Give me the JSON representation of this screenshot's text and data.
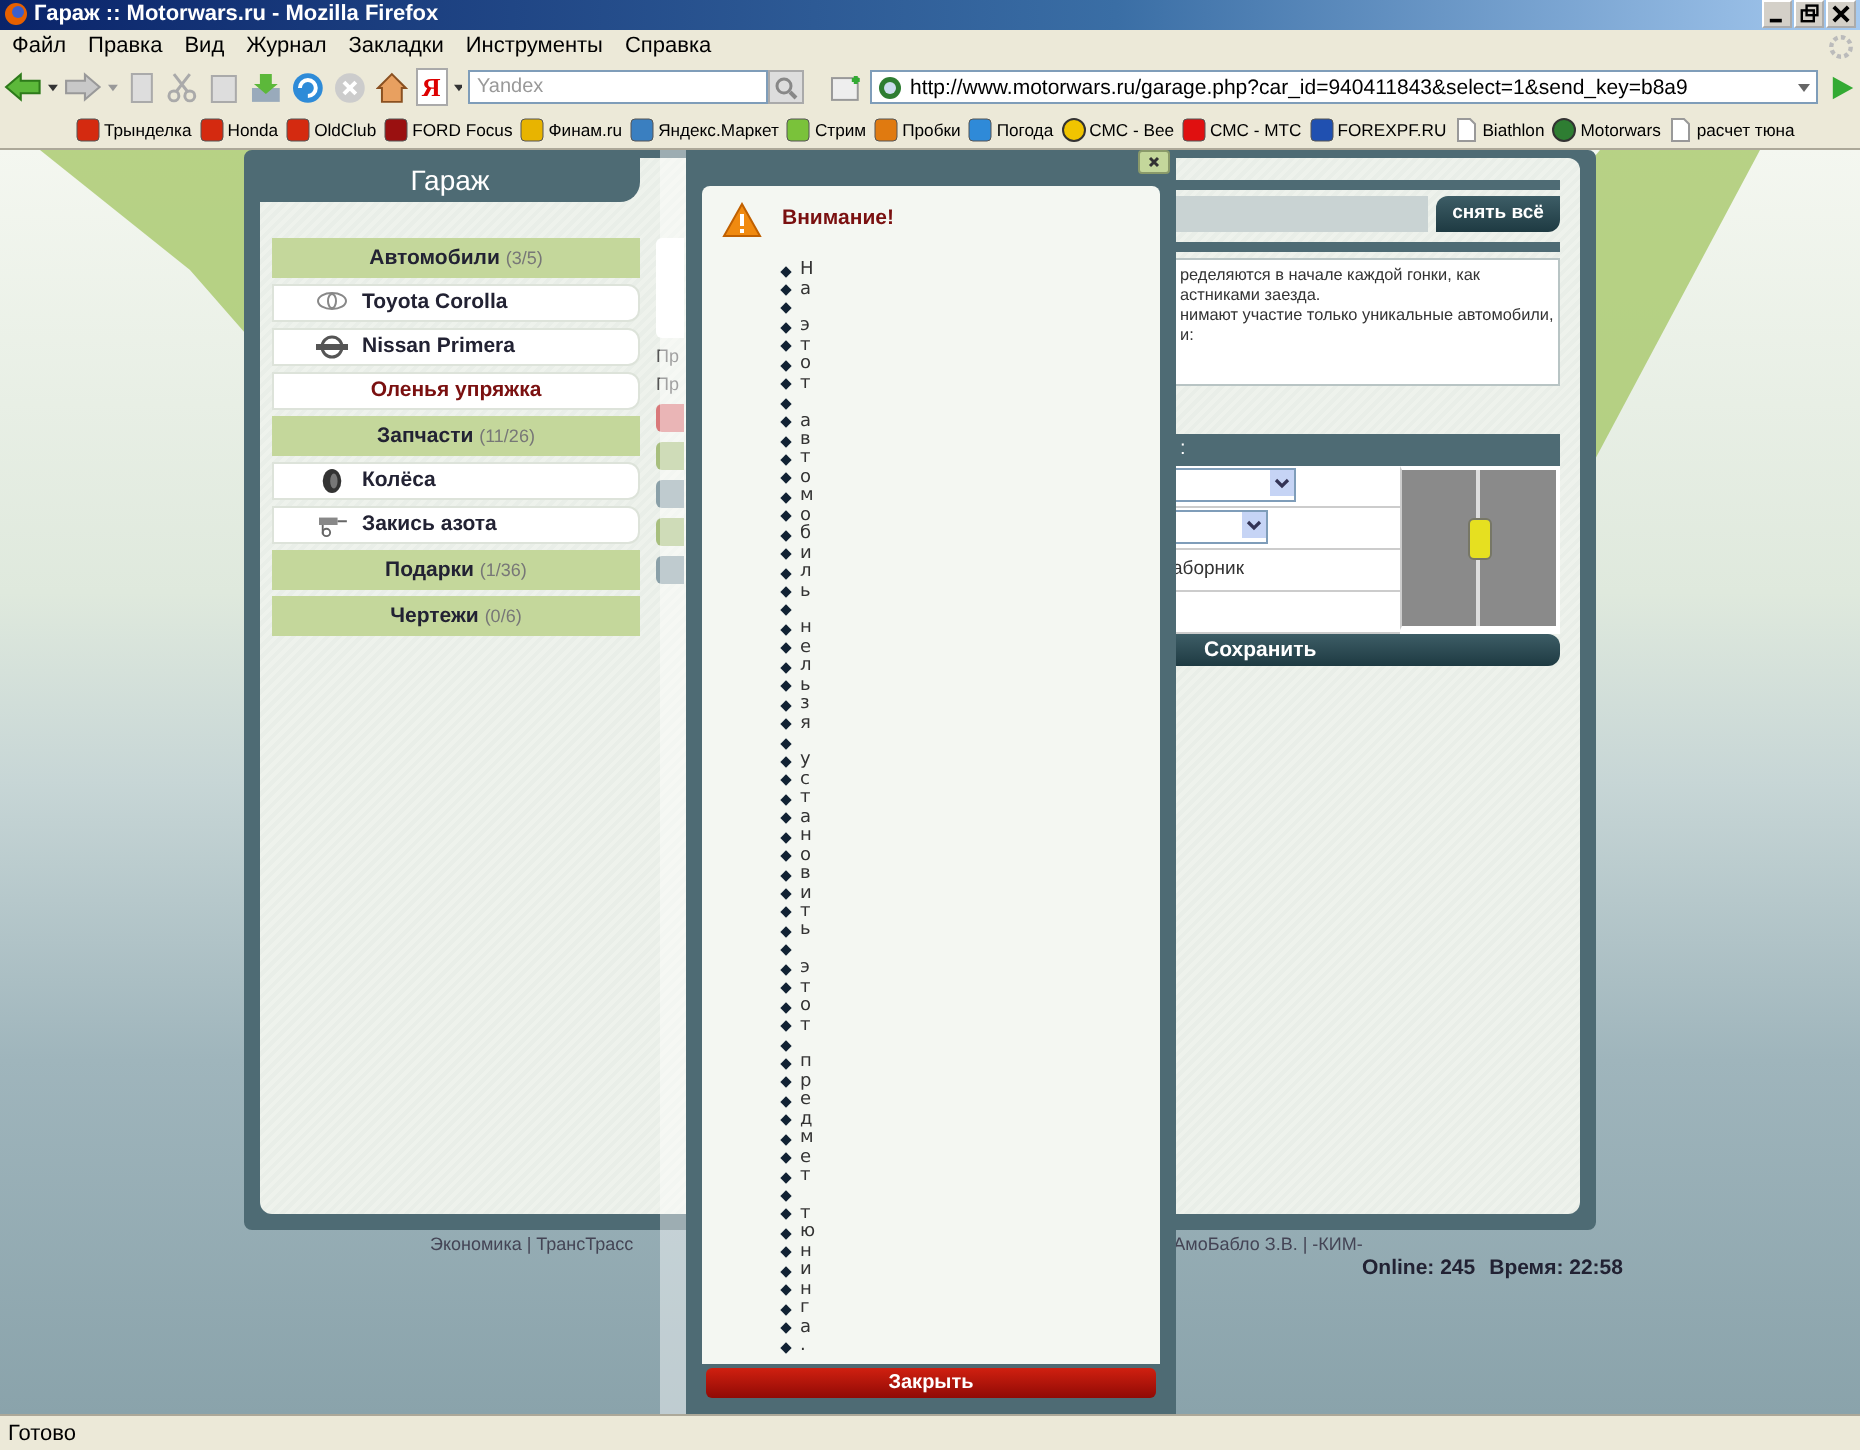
{
  "window": {
    "title": "Гараж :: Motorwars.ru - Mozilla Firefox"
  },
  "menu": [
    "Файл",
    "Правка",
    "Вид",
    "Журнал",
    "Закладки",
    "Инструменты",
    "Справка"
  ],
  "toolbar": {
    "engine_label": "Я",
    "search": {
      "placeholder": "Yandex"
    },
    "address": {
      "value": "http://www.motorwars.ru/garage.php?car_id=940411843&select=1&send_key=b8a9"
    }
  },
  "bookmarks": [
    {
      "label": "Трынделка",
      "kind": "forum"
    },
    {
      "label": "Honda",
      "kind": "forum"
    },
    {
      "label": "OldClub",
      "kind": "forum"
    },
    {
      "label": "FORD Focus",
      "kind": "car"
    },
    {
      "label": "Финам.ru",
      "kind": "pen"
    },
    {
      "label": "Яндекс.Маркет",
      "kind": "market"
    },
    {
      "label": "Стрим",
      "kind": "stream"
    },
    {
      "label": "Пробки",
      "kind": "traffic"
    },
    {
      "label": "Погода",
      "kind": "weather"
    },
    {
      "label": "СМС - Bee",
      "kind": "beeline"
    },
    {
      "label": "СМС - МТС",
      "kind": "mts"
    },
    {
      "label": "FOREXPF.RU",
      "kind": "forex"
    },
    {
      "label": "Biathlon",
      "kind": "page"
    },
    {
      "label": "Motorwars",
      "kind": "site"
    },
    {
      "label": "расчет тюна",
      "kind": "page"
    }
  ],
  "garage": {
    "title": "Гараж",
    "sections": [
      {
        "title": "Автомобили",
        "count": "(3/5)",
        "items": [
          {
            "label": "Toyota Corolla",
            "kind": "toyota",
            "selected": false
          },
          {
            "label": "Nissan Primera",
            "kind": "nissan",
            "selected": false
          },
          {
            "label": "Оленья упряжка",
            "kind": "plain",
            "selected": true
          }
        ]
      },
      {
        "title": "Запчасти",
        "count": "(11/26)",
        "items": [
          {
            "label": "Колёса",
            "kind": "wheel",
            "selected": false
          },
          {
            "label": "Закись азота",
            "kind": "nitro",
            "selected": false
          }
        ]
      },
      {
        "title": "Подарки",
        "count": "(1/36)"
      },
      {
        "title": "Чертежи",
        "count": "(0/6)"
      }
    ]
  },
  "side_column": {
    "texts": [
      "Пр",
      "Пр"
    ]
  },
  "details": {
    "clear_button": "снять всё",
    "info_lines": [
      "ределяются в начале каждой гонки, как",
      "астниками заезда.",
      "нимают участие только уникальные автомобили,",
      "и:"
    ],
    "header_text": ":",
    "form_rows": [
      {
        "kind": "select"
      },
      {
        "kind": "select"
      },
      {
        "kind": "text",
        "text": "аборник"
      },
      {
        "kind": "empty"
      }
    ],
    "save_button": "Сохранить"
  },
  "modal": {
    "title": "Внимание!",
    "message": "На этот автомобиль нельзя установить этот предмет тюнинга.",
    "close_button": "Закрыть"
  },
  "footer": {
    "links_left": "Экономика | ТрансТрасс",
    "links_right": "АмоБабло З.В. | -КИМ-",
    "online": "Online: 245",
    "time": "Время: 22:58"
  },
  "status_bar": "Готово"
}
